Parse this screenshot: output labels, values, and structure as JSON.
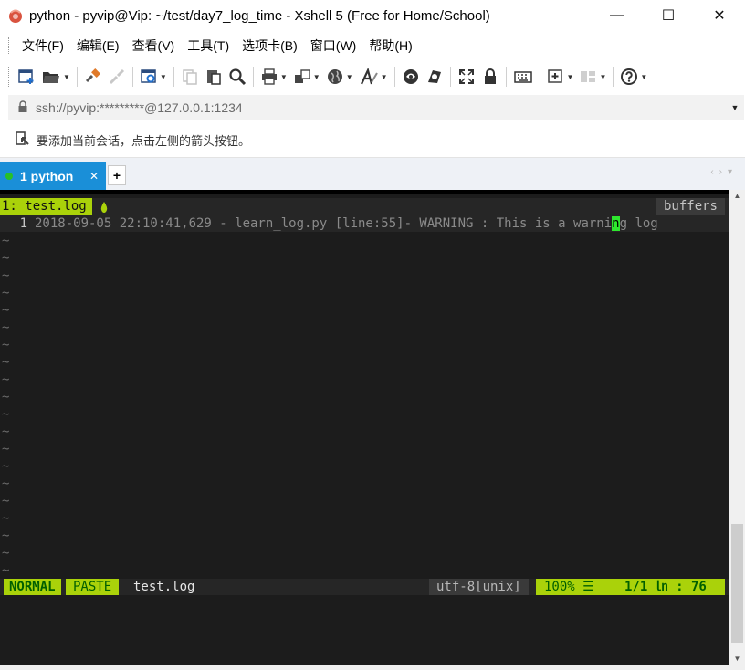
{
  "window": {
    "title": "python - pyvip@Vip: ~/test/day7_log_time - Xshell 5 (Free for Home/School)",
    "minimize_glyph": "—",
    "maximize_glyph": "☐",
    "close_glyph": "✕"
  },
  "menu": {
    "items": [
      "文件(F)",
      "编辑(E)",
      "查看(V)",
      "工具(T)",
      "选项卡(B)",
      "窗口(W)",
      "帮助(H)"
    ]
  },
  "toolbar": {
    "icons": [
      "new-session-icon",
      "open-folder-icon",
      "reconnect-icon",
      "disconnect-icon",
      "properties-icon",
      "copy-icon",
      "paste-icon",
      "find-icon",
      "print-icon",
      "transfer-icon",
      "globe-icon",
      "font-icon",
      "xftp-icon",
      "xmanager-icon",
      "fullscreen-icon",
      "lock-icon",
      "keyboard-icon",
      "compose-icon",
      "layout-icon",
      "help-icon"
    ]
  },
  "address": {
    "value": "ssh://pyvip:*********@127.0.0.1:1234"
  },
  "hint": {
    "text": "要添加当前会话，点击左侧的箭头按钮。"
  },
  "tabs": {
    "active_label": "1 python",
    "add_label": "+",
    "nav_glyphs": "‹›▾"
  },
  "terminal": {
    "buffer_tab": "1: test.log",
    "buffers_label": "buffers",
    "line_number": "1",
    "line_before_cursor": "2018-09-05 22:10:41,629 - learn_log.py [line:55]- WARNING : This is a warni",
    "cursor_char": "n",
    "line_after_cursor": "g log",
    "tilde": "~",
    "status": {
      "mode": "NORMAL",
      "paste": "PASTE",
      "file": "test.log",
      "encoding": "utf-8[unix]",
      "percent": "100% ☰",
      "position": "1/1 ㏑ : 76"
    }
  },
  "colors": {
    "accent_tab": "#1a8fd8",
    "vim_green": "#aad20a",
    "cursor": "#2ee82e",
    "terminal_bg": "#1c1c1c"
  }
}
